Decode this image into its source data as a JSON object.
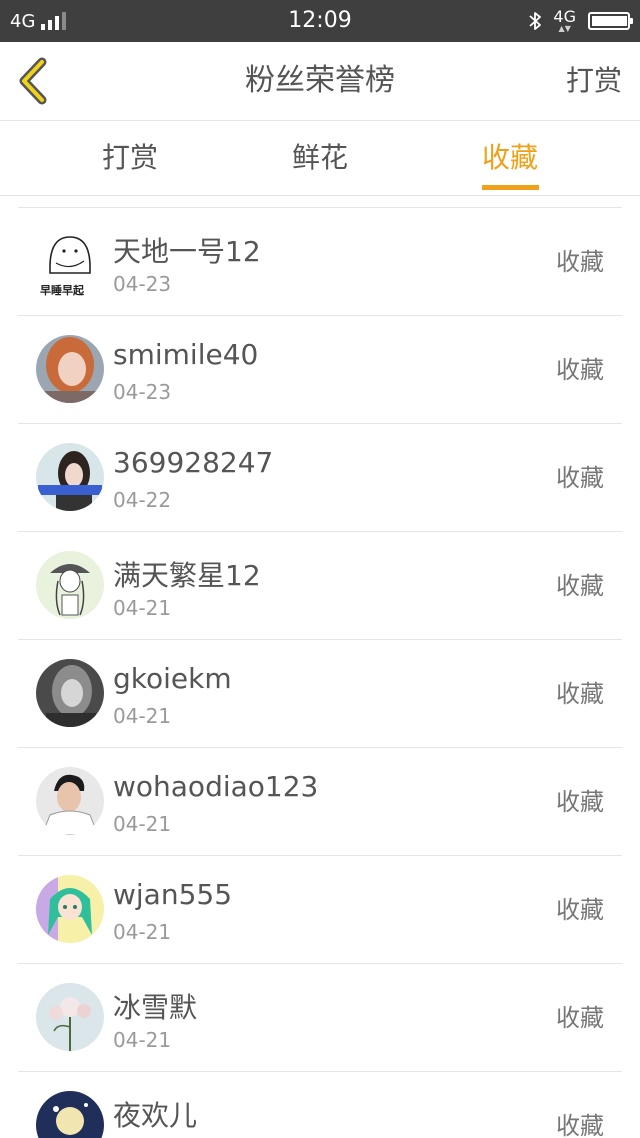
{
  "status_bar": {
    "network": "4G",
    "time": "12:09",
    "network_right": "4G",
    "icons": [
      "signal-icon",
      "bluetooth-icon",
      "battery-icon"
    ]
  },
  "header": {
    "title": "粉丝荣誉榜",
    "action_label": "打赏",
    "back_icon": "chevron-left-icon",
    "accent_color": "#f0a11a"
  },
  "tabs": [
    {
      "label": "打赏",
      "active": false
    },
    {
      "label": "鲜花",
      "active": false
    },
    {
      "label": "收藏",
      "active": true
    }
  ],
  "list": {
    "items": [
      {
        "name": "天地一号12",
        "date": "04-23",
        "type": "收藏",
        "avatar_caption": "早睡早起"
      },
      {
        "name": "smimile40",
        "date": "04-23",
        "type": "收藏"
      },
      {
        "name": "369928247",
        "date": "04-22",
        "type": "收藏"
      },
      {
        "name": "满天繁星12",
        "date": "04-21",
        "type": "收藏"
      },
      {
        "name": "gkoiekm",
        "date": "04-21",
        "type": "收藏"
      },
      {
        "name": "wohaodiao123",
        "date": "04-21",
        "type": "收藏"
      },
      {
        "name": "wjan555",
        "date": "04-21",
        "type": "收藏"
      },
      {
        "name": "冰雪默",
        "date": "04-21",
        "type": "收藏"
      },
      {
        "name": "夜欢儿",
        "date": "",
        "type": "收藏"
      }
    ]
  }
}
